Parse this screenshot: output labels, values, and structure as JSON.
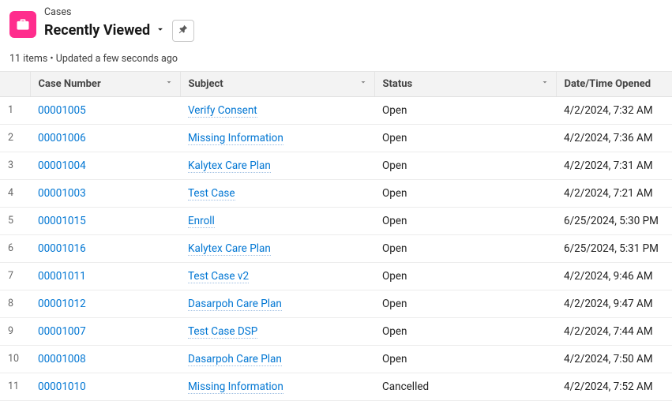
{
  "header": {
    "object_label": "Cases",
    "listview_name": "Recently Viewed",
    "meta": "11 items • Updated a few seconds ago"
  },
  "columns": {
    "case_number": "Case Number",
    "subject": "Subject",
    "status": "Status",
    "date_opened": "Date/Time Opened"
  },
  "rows": [
    {
      "n": "1",
      "case_number": "00001005",
      "subject": "Verify Consent",
      "status": "Open",
      "date": "4/2/2024, 7:32 AM"
    },
    {
      "n": "2",
      "case_number": "00001006",
      "subject": "Missing Information",
      "status": "Open",
      "date": "4/2/2024, 7:36 AM"
    },
    {
      "n": "3",
      "case_number": "00001004",
      "subject": "Kalytex Care Plan",
      "status": "Open",
      "date": "4/2/2024, 7:31 AM"
    },
    {
      "n": "4",
      "case_number": "00001003",
      "subject": "Test Case",
      "status": "Open",
      "date": "4/2/2024, 7:21 AM"
    },
    {
      "n": "5",
      "case_number": "00001015",
      "subject": "Enroll",
      "status": "Open",
      "date": "6/25/2024, 5:30 PM"
    },
    {
      "n": "6",
      "case_number": "00001016",
      "subject": "Kalytex Care Plan",
      "status": "Open",
      "date": "6/25/2024, 5:31 PM"
    },
    {
      "n": "7",
      "case_number": "00001011",
      "subject": "Test Case v2",
      "status": "Open",
      "date": "4/2/2024, 9:46 AM"
    },
    {
      "n": "8",
      "case_number": "00001012",
      "subject": "Dasarpoh Care Plan",
      "status": "Open",
      "date": "4/2/2024, 9:47 AM"
    },
    {
      "n": "9",
      "case_number": "00001007",
      "subject": "Test Case DSP",
      "status": "Open",
      "date": "4/2/2024, 7:44 AM"
    },
    {
      "n": "10",
      "case_number": "00001008",
      "subject": "Dasarpoh Care Plan",
      "status": "Open",
      "date": "4/2/2024, 7:50 AM"
    },
    {
      "n": "11",
      "case_number": "00001010",
      "subject": "Missing Information",
      "status": "Cancelled",
      "date": "4/2/2024, 7:52 AM"
    }
  ]
}
